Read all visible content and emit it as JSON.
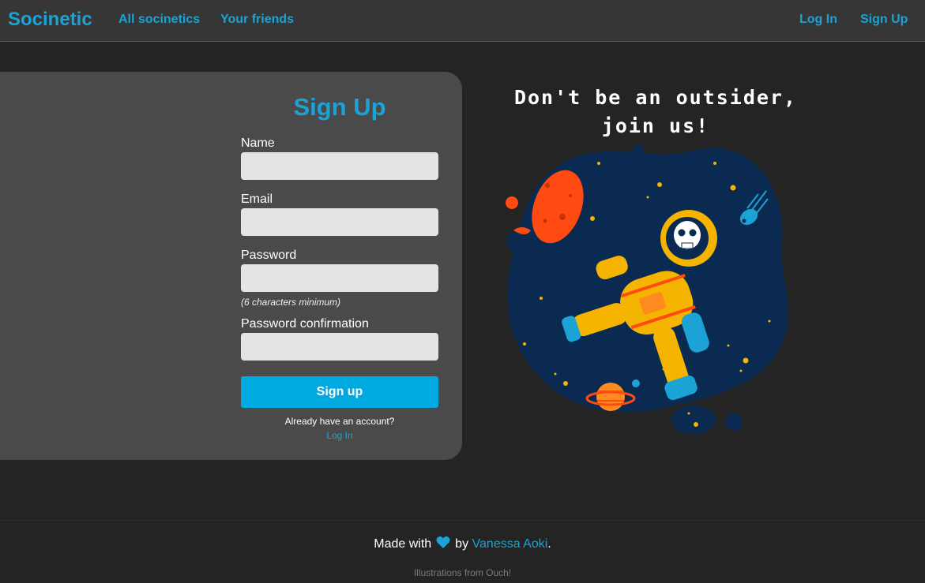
{
  "nav": {
    "brand": "Socinetic",
    "links": [
      "All socinetics",
      "Your friends"
    ],
    "auth": [
      "Log In",
      "Sign Up"
    ]
  },
  "form": {
    "title": "Sign Up",
    "name_label": "Name",
    "name_value": "",
    "email_label": "Email",
    "email_value": "",
    "password_label": "Password",
    "password_value": "",
    "password_hint": "(6 characters minimum)",
    "confirm_label": "Password confirmation",
    "confirm_value": "",
    "submit_label": "Sign up",
    "account_text": "Already have an account?",
    "login_link": "Log In"
  },
  "hero": {
    "tagline_line1": "Don't be an outsider,",
    "tagline_line2": "join us!",
    "illustration_icon": "astronaut-illustration"
  },
  "footer": {
    "made_with": "Made with",
    "heart_icon": "heart-icon",
    "by": "by",
    "author": "Vanessa Aoki",
    "period": ".",
    "credits": "Illustrations from Ouch!"
  },
  "colors": {
    "accent": "#1aa3d4",
    "button": "#00a9e0",
    "background": "#242424",
    "navbar": "#363636",
    "card": "#4a4a4a",
    "input": "#e4e4e4"
  }
}
